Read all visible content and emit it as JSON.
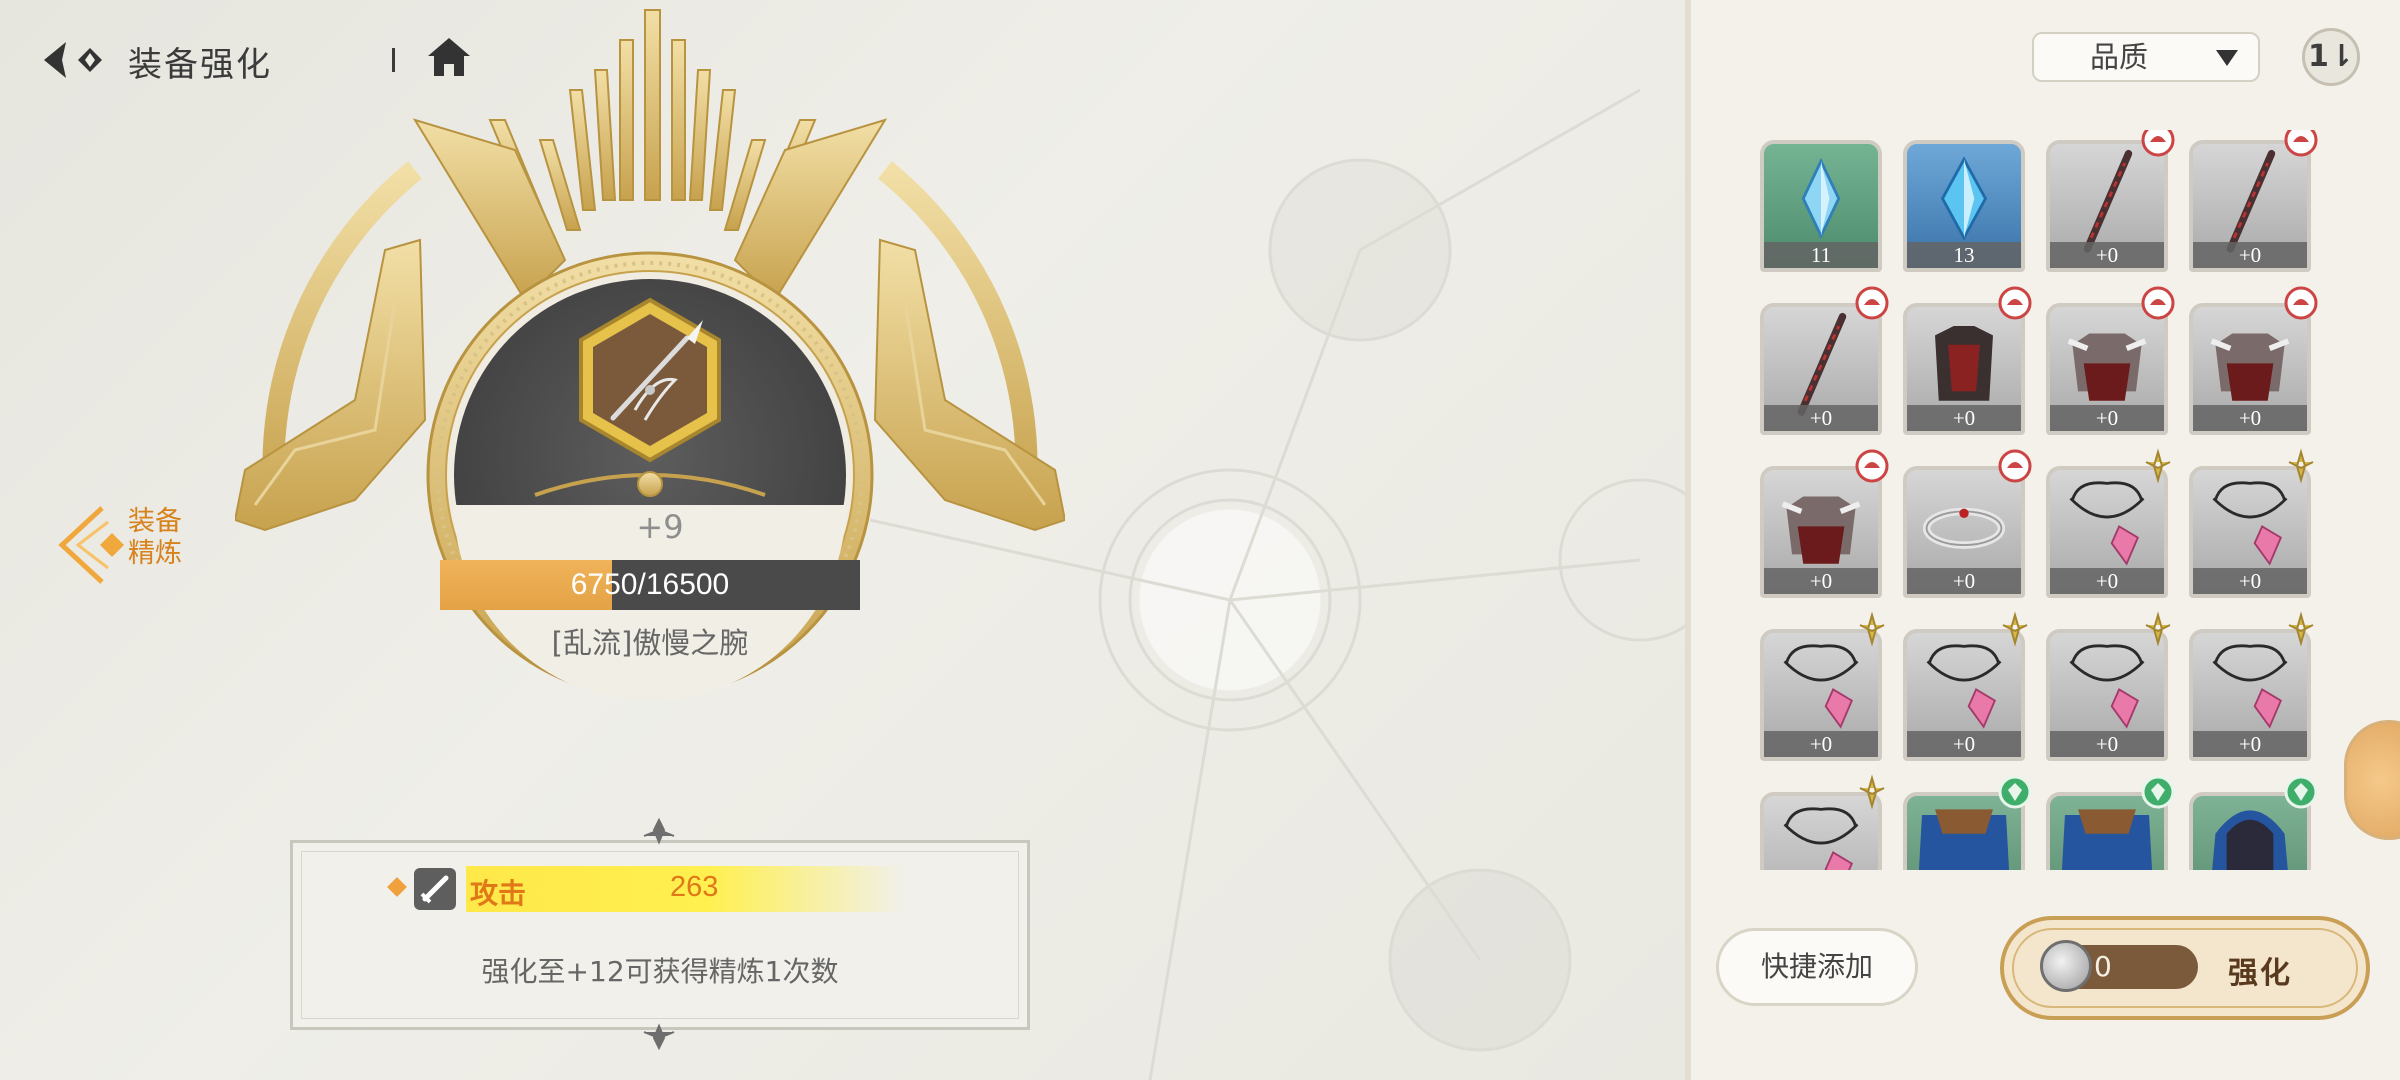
{
  "header": {
    "title": "装备强化"
  },
  "side_tab": {
    "label": "装备精炼"
  },
  "equipment": {
    "level": "+9",
    "exp_text": "6750/16500",
    "exp_current": 6750,
    "exp_max": 16500,
    "name": "[乱流]傲慢之腕"
  },
  "stat": {
    "name": "攻击",
    "value": "263"
  },
  "hint": "强化至+12可获得精炼1次数",
  "sort": {
    "selected": "品质"
  },
  "inventory": [
    {
      "count": "11",
      "kind": "crystal-green",
      "badge": ""
    },
    {
      "count": "13",
      "kind": "crystal-blue",
      "badge": ""
    },
    {
      "count": "+0",
      "kind": "sword",
      "badge": "red"
    },
    {
      "count": "+0",
      "kind": "sword",
      "badge": "red"
    },
    {
      "count": "+0",
      "kind": "sword",
      "badge": "red"
    },
    {
      "count": "+0",
      "kind": "armor",
      "badge": "red"
    },
    {
      "count": "+0",
      "kind": "helmet",
      "badge": "red"
    },
    {
      "count": "+0",
      "kind": "helmet",
      "badge": "red"
    },
    {
      "count": "+0",
      "kind": "helmet",
      "badge": "red"
    },
    {
      "count": "+0",
      "kind": "bracelet",
      "badge": "red"
    },
    {
      "count": "+0",
      "kind": "necklace",
      "badge": "gold"
    },
    {
      "count": "+0",
      "kind": "necklace",
      "badge": "gold"
    },
    {
      "count": "+0",
      "kind": "necklace",
      "badge": "gold"
    },
    {
      "count": "+0",
      "kind": "necklace",
      "badge": "gold"
    },
    {
      "count": "+0",
      "kind": "necklace",
      "badge": "gold"
    },
    {
      "count": "+0",
      "kind": "necklace",
      "badge": "gold"
    },
    {
      "count": "",
      "kind": "necklace",
      "badge": "gold"
    },
    {
      "count": "",
      "kind": "cloak",
      "badge": "green"
    },
    {
      "count": "",
      "kind": "cloak",
      "badge": "green"
    },
    {
      "count": "",
      "kind": "cloak-hood",
      "badge": "green"
    }
  ],
  "actions": {
    "quick_add": "快捷添加",
    "enhance": "强化",
    "cost": "0"
  },
  "colors": {
    "accent_orange": "#e07818",
    "gold": "#c9a24a",
    "panel_bg": "#f3f1ea"
  }
}
